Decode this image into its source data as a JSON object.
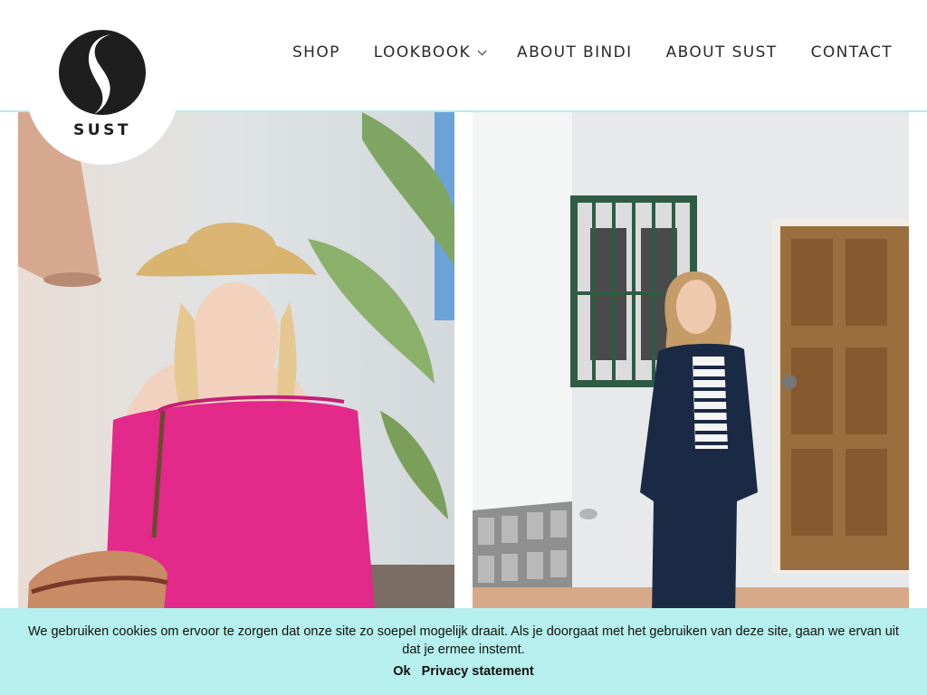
{
  "brand": {
    "logo_text": "SUST",
    "logo_color": "#1e1e1e"
  },
  "nav": {
    "items": [
      {
        "label": "SHOP",
        "has_dropdown": false
      },
      {
        "label": "LOOKBOOK",
        "has_dropdown": true
      },
      {
        "label": "ABOUT BINDI",
        "has_dropdown": false
      },
      {
        "label": "ABOUT SUST",
        "has_dropdown": false
      },
      {
        "label": "CONTACT",
        "has_dropdown": false
      }
    ]
  },
  "gallery": [
    {
      "name": "woman in pink off-shoulder blouse with straw hat and basket"
    },
    {
      "name": "woman in navy suit with striped top by white wall"
    }
  ],
  "cookie_bar": {
    "message": "We gebruiken cookies om ervoor te zorgen dat onze site zo soepel mogelijk draait. Als je doorgaat met het gebruiken van deze site, gaan we ervan uit dat je ermee instemt.",
    "ok_label": "Ok",
    "privacy_label": "Privacy statement",
    "background": "#b5efee"
  },
  "colors": {
    "header_border": "#b8ecec",
    "text": "#2a2a2a"
  }
}
